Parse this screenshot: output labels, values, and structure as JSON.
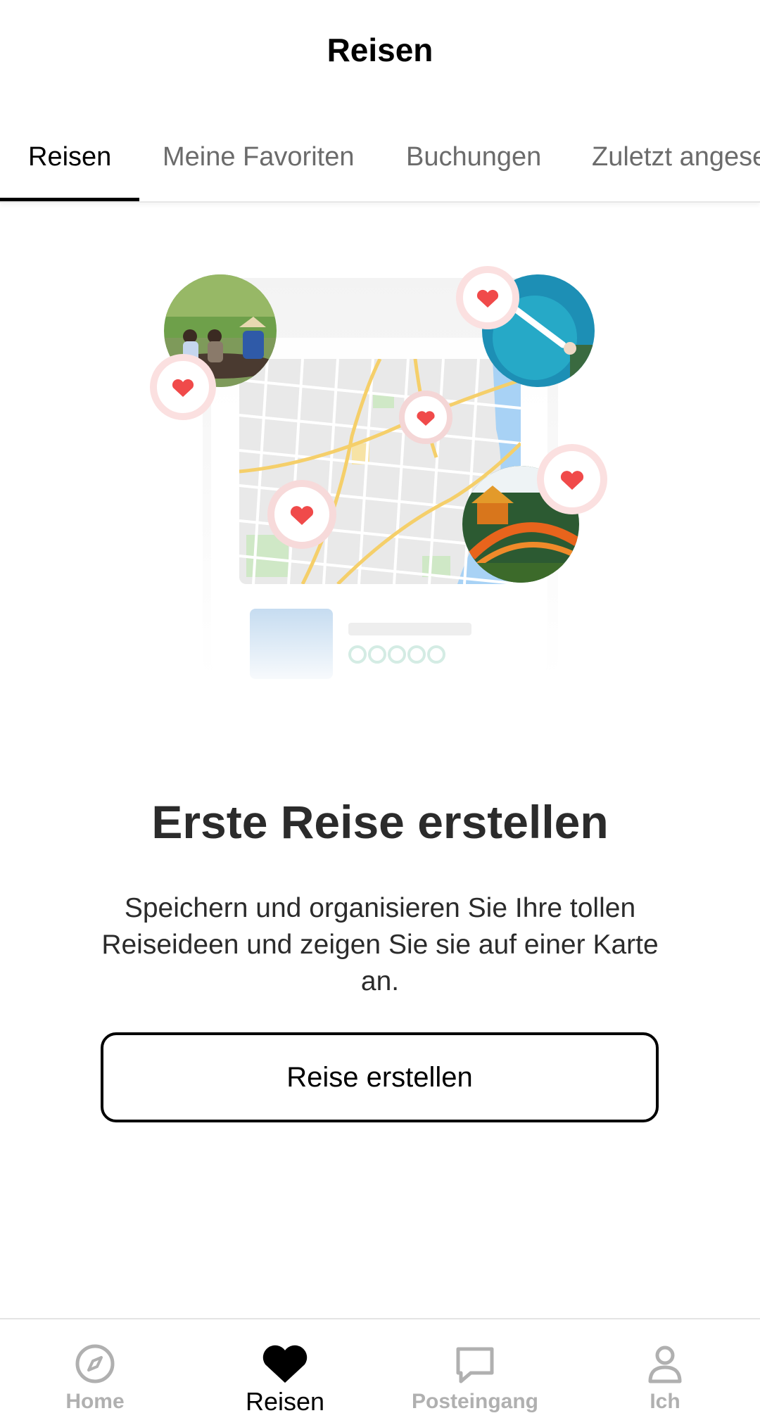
{
  "header": {
    "title": "Reisen"
  },
  "tabs": [
    {
      "label": "Reisen",
      "active": true
    },
    {
      "label": "Meine Favoriten",
      "active": false
    },
    {
      "label": "Buchungen",
      "active": false
    },
    {
      "label": "Zuletzt angesehen",
      "active": false
    }
  ],
  "illustration": {
    "icons": [
      "heart-pin-icon",
      "map-icon",
      "travel-photo-icon"
    ]
  },
  "empty_state": {
    "title": "Erste Reise erstellen",
    "description": "Speichern und organisieren Sie Ihre tollen Reiseideen und zeigen Sie sie auf einer Karte an.",
    "button_label": "Reise erstellen"
  },
  "bottom_nav": {
    "items": [
      {
        "label": "Home",
        "icon": "compass-icon",
        "active": false
      },
      {
        "label": "Reisen",
        "icon": "heart-icon",
        "active": true
      },
      {
        "label": "Posteingang",
        "icon": "message-icon",
        "active": false
      },
      {
        "label": "Ich",
        "icon": "person-icon",
        "active": false
      }
    ]
  },
  "colors": {
    "accent_heart": "#f04a4a",
    "tab_active": "#000000",
    "tab_inactive": "#6b6b6b",
    "nav_inactive": "#b0b0b0"
  }
}
